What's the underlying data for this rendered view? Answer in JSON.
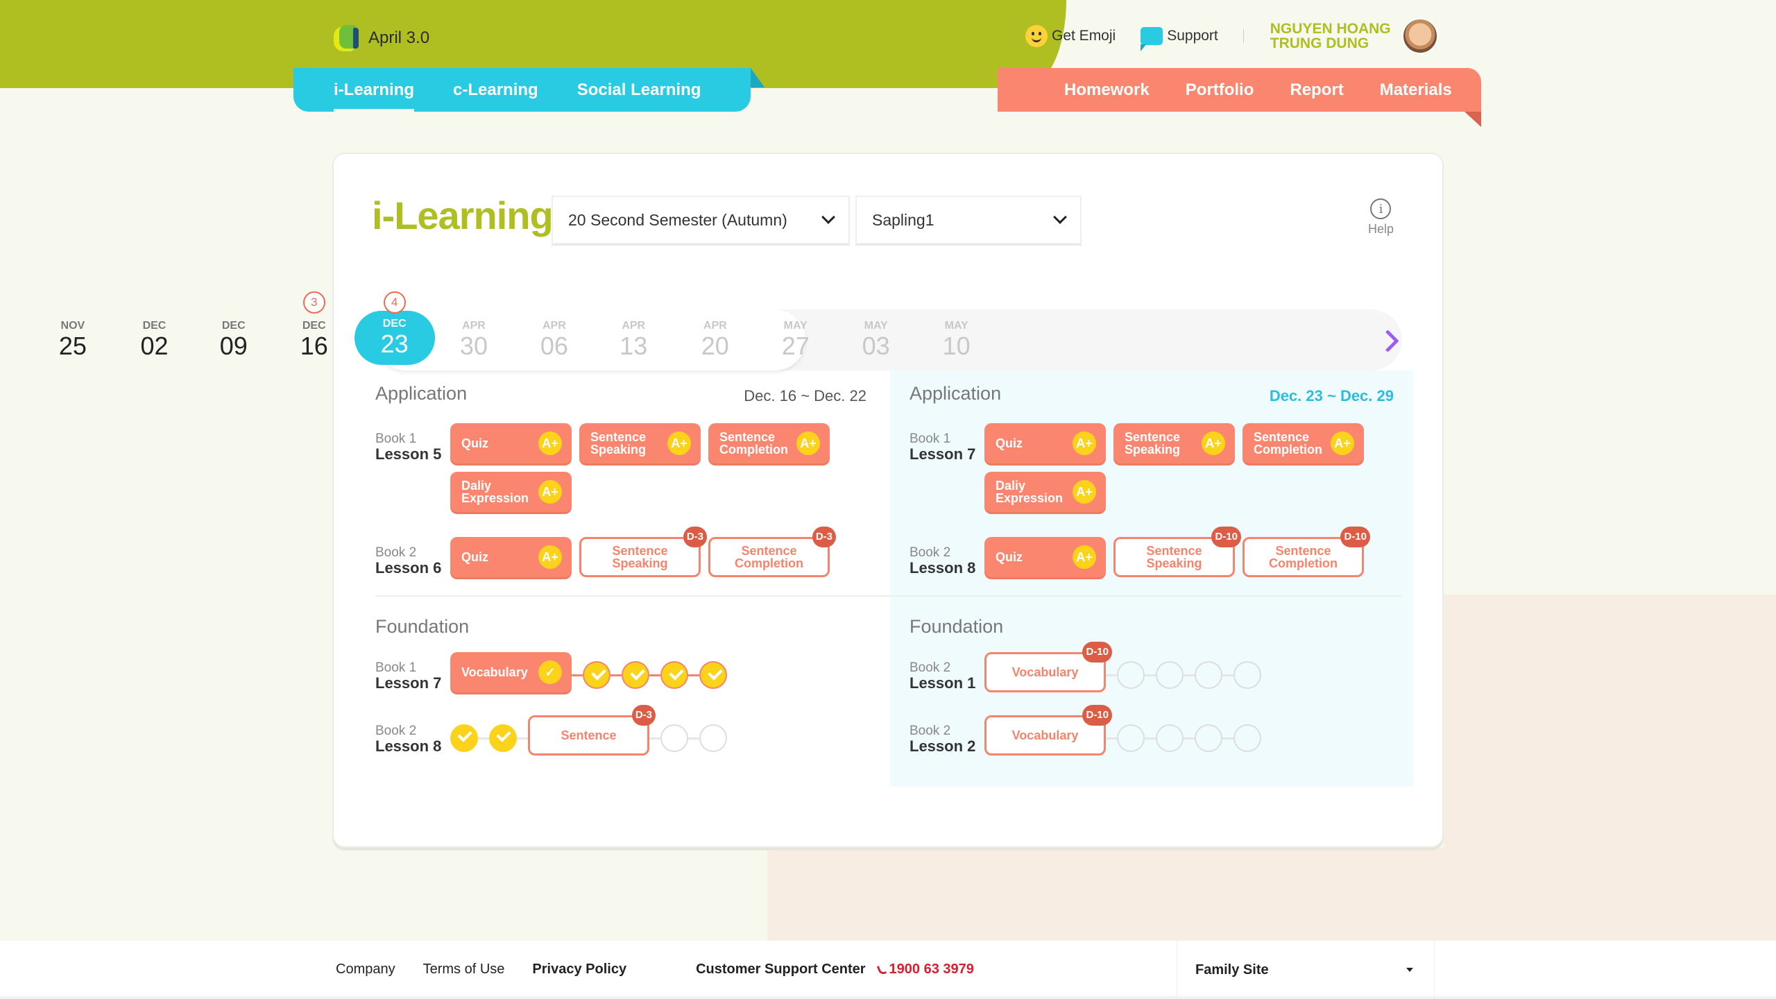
{
  "app": {
    "logo_text": "April 3.0"
  },
  "header": {
    "main_tabs": [
      {
        "label": "i-Learning",
        "active": true
      },
      {
        "label": "c-Learning",
        "active": false
      },
      {
        "label": "Social Learning",
        "active": false
      }
    ],
    "utility": {
      "emoji_label": "Get Emoji",
      "support_label": "Support"
    },
    "user": {
      "name_line1": "NGUYEN HOANG",
      "name_line2": "TRUNG DUNG"
    },
    "right_tabs": [
      "Homework",
      "Portfolio",
      "Report",
      "Materials"
    ]
  },
  "page": {
    "title": "i-Learning",
    "semester_select": "20 Second Semester (Autumn)",
    "class_select": "Sapling1",
    "help_label": "Help"
  },
  "timeline": {
    "items": [
      {
        "month": "NOV",
        "day": "25",
        "state": "past"
      },
      {
        "month": "DEC",
        "day": "02",
        "state": "past"
      },
      {
        "month": "DEC",
        "day": "09",
        "state": "past"
      },
      {
        "month": "DEC",
        "day": "16",
        "state": "past",
        "badge": "3"
      },
      {
        "month": "DEC",
        "day": "23",
        "state": "selected",
        "badge": "4"
      },
      {
        "month": "APR",
        "day": "30",
        "state": "future"
      },
      {
        "month": "APR",
        "day": "06",
        "state": "future"
      },
      {
        "month": "APR",
        "day": "13",
        "state": "future"
      },
      {
        "month": "APR",
        "day": "20",
        "state": "future"
      },
      {
        "month": "MAY",
        "day": "27",
        "state": "future"
      },
      {
        "month": "MAY",
        "day": "03",
        "state": "future"
      },
      {
        "month": "MAY",
        "day": "10",
        "state": "future"
      }
    ]
  },
  "weeks": {
    "previous": {
      "application_title": "Application",
      "range": "Dec. 16 ~ Dec. 22",
      "application": [
        {
          "book": "Book 1",
          "lesson": "Lesson 5",
          "tasks": [
            {
              "label": "Quiz",
              "grade": "A+"
            },
            {
              "label": "Sentence Speaking",
              "grade": "A+"
            },
            {
              "label": "Sentence Completion",
              "grade": "A+"
            },
            {
              "label": "Daliy Expression",
              "grade": "A+"
            }
          ]
        },
        {
          "book": "Book 2",
          "lesson": "Lesson 6",
          "tasks": [
            {
              "label": "Quiz",
              "grade": "A+"
            },
            {
              "label": "Sentence Speaking",
              "dday": "D-3"
            },
            {
              "label": "Sentence Completion",
              "dday": "D-3"
            }
          ]
        }
      ],
      "foundation_title": "Foundation",
      "foundation": [
        {
          "book": "Book 1",
          "lesson": "Lesson 7",
          "task": "Vocabulary",
          "completed_steps": 5,
          "total_steps": 5
        },
        {
          "book": "Book 2",
          "lesson": "Lesson 8",
          "task": "Sentence",
          "dday": "D-3",
          "completed_steps": 2,
          "total_steps": 5
        }
      ]
    },
    "current": {
      "application_title": "Application",
      "range": "Dec. 23 ~ Dec. 29",
      "application": [
        {
          "book": "Book 1",
          "lesson": "Lesson 7",
          "tasks": [
            {
              "label": "Quiz",
              "grade": "A+"
            },
            {
              "label": "Sentence Speaking",
              "grade": "A+"
            },
            {
              "label": "Sentence Completion",
              "grade": "A+"
            },
            {
              "label": "Daliy Expression",
              "grade": "A+"
            }
          ]
        },
        {
          "book": "Book 2",
          "lesson": "Lesson 8",
          "tasks": [
            {
              "label": "Quiz",
              "grade": "A+"
            },
            {
              "label": "Sentence Speaking",
              "dday": "D-10"
            },
            {
              "label": "Sentence Completion",
              "dday": "D-10"
            }
          ]
        }
      ],
      "foundation_title": "Foundation",
      "foundation": [
        {
          "book": "Book 2",
          "lesson": "Lesson 1",
          "task": "Vocabulary",
          "dday": "D-10",
          "completed_steps": 0,
          "total_steps": 5
        },
        {
          "book": "Book 2",
          "lesson": "Lesson 2",
          "task": "Vocabulary",
          "dday": "D-10",
          "completed_steps": 0,
          "total_steps": 5
        }
      ]
    }
  },
  "footer": {
    "links": [
      "Company",
      "Terms of Use",
      "Privacy Policy"
    ],
    "support_label": "Customer Support Center",
    "phone": "1900 63 3979",
    "family_site": "Family Site"
  },
  "colors": {
    "brand_green": "#afbe20",
    "cyan": "#29cbe3",
    "salmon": "#fb8670",
    "grade_yellow": "#fbd31b",
    "dday_red": "#db5d46",
    "purple_arrow": "#9a5cf5"
  }
}
